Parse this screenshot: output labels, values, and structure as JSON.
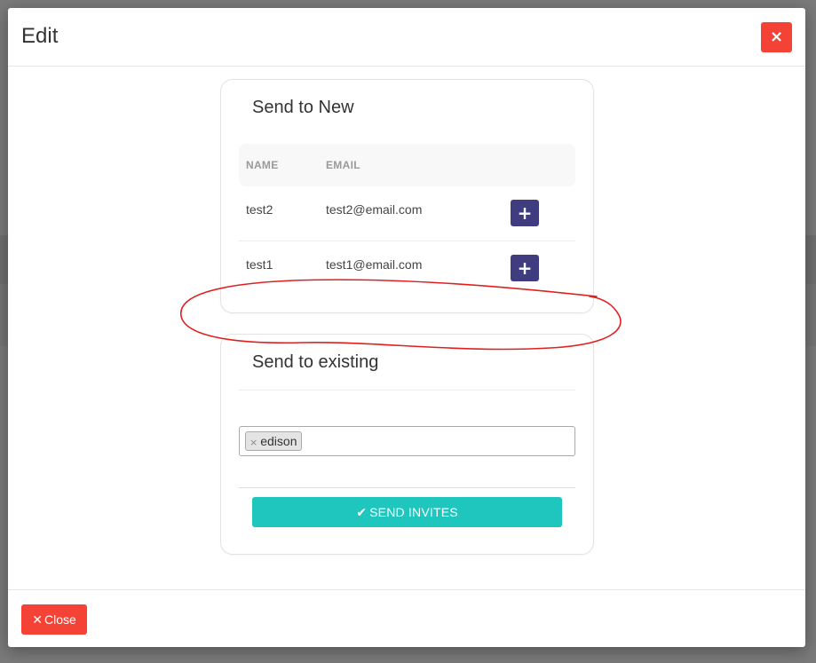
{
  "modal": {
    "title": "Edit",
    "header_close_icon": "×",
    "footer_close_icon": "✕",
    "footer_close_label": "Close"
  },
  "send_new": {
    "title": "Send to New",
    "columns": [
      "NAME",
      "EMAIL"
    ],
    "rows": [
      {
        "name": "test2",
        "email": "test2@email.com",
        "action_icon": "+"
      },
      {
        "name": "test1",
        "email": "test1@email.com",
        "action_icon": "+"
      }
    ]
  },
  "send_existing": {
    "title": "Send to existing",
    "tags": [
      {
        "label": "edison",
        "remove_icon": "×"
      }
    ],
    "send_icon": "✔",
    "send_label": "SEND INVITES"
  },
  "colors": {
    "danger": "#f44336",
    "add_button": "#3f3d7f",
    "send_button": "#1ec6be",
    "annotation": "#e02020"
  }
}
